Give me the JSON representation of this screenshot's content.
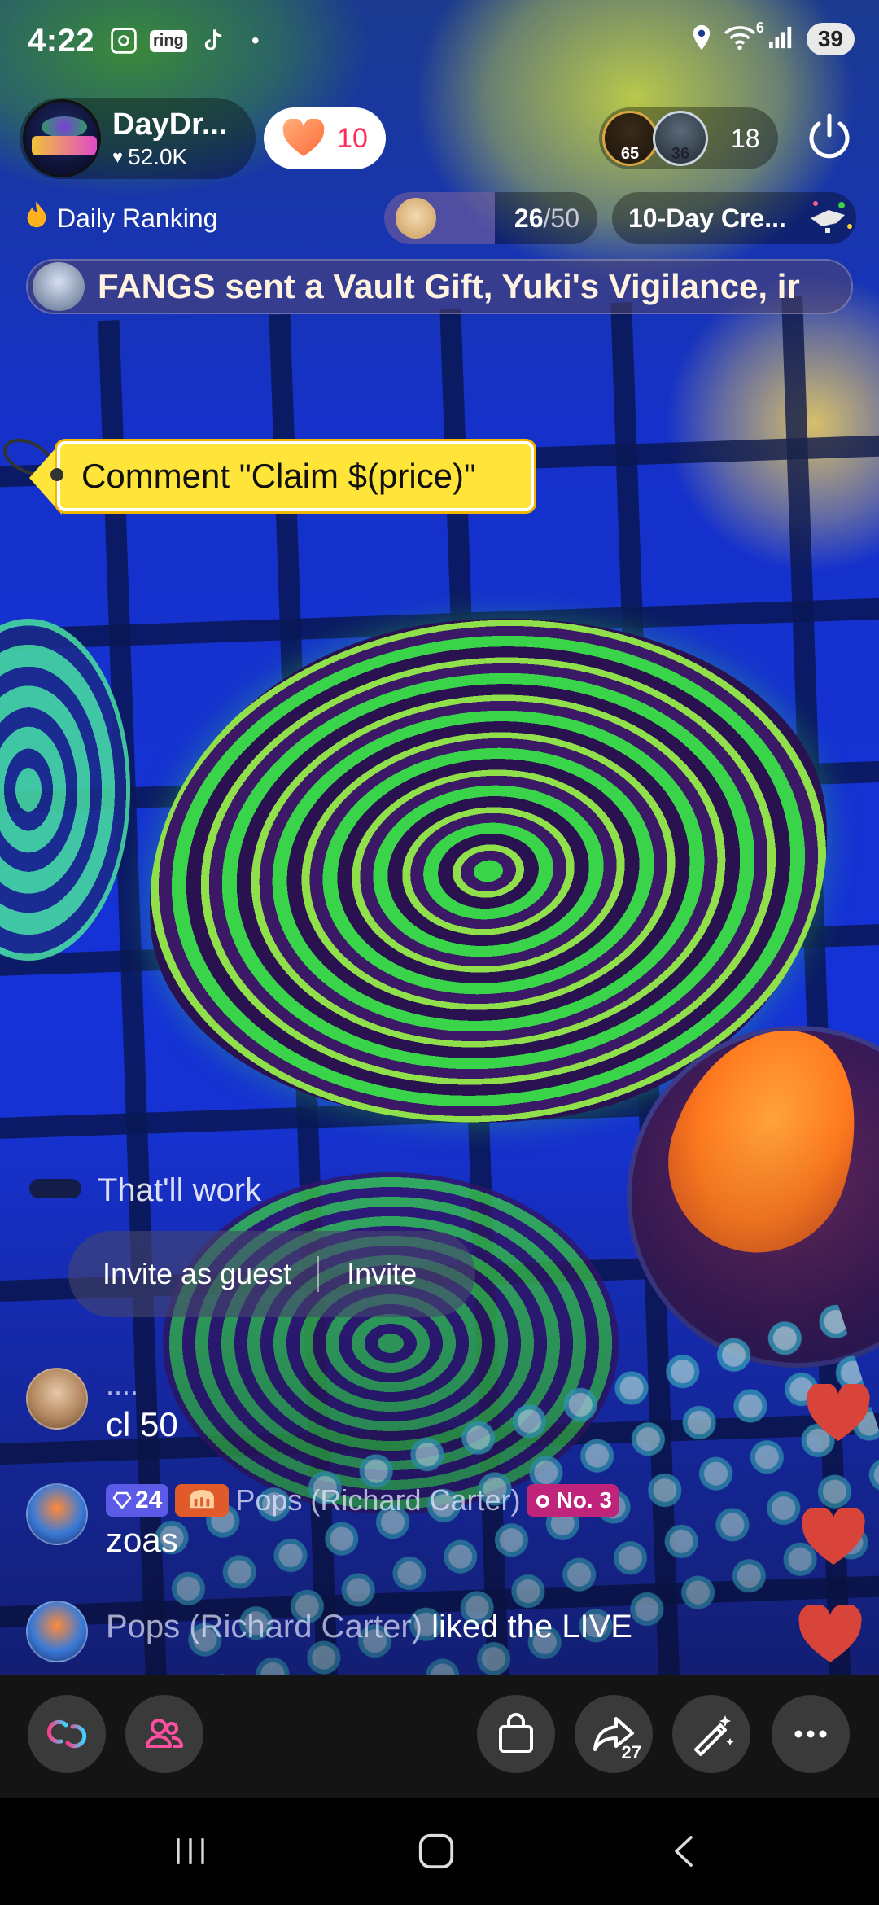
{
  "status_bar": {
    "time": "4:22",
    "left_icons": [
      "screenshot-icon",
      "ring-icon",
      "tiktok-icon",
      "dot-icon"
    ],
    "ring_label": "ring",
    "right_icons": [
      "location-icon",
      "wifi-icon",
      "signal-icon"
    ],
    "wifi_label": "6",
    "battery": "39"
  },
  "host": {
    "name": "DayDr...",
    "likes": "52.0K"
  },
  "follow": {
    "count": "10"
  },
  "viewers": {
    "badge_1": "65",
    "badge_2": "36",
    "count": "18"
  },
  "ranking": {
    "label": "Daily Ranking",
    "progress_current": "26",
    "progress_total": "/50",
    "progress_fraction": 0.52,
    "challenge_label": "10-Day Cre..."
  },
  "gift_banner": {
    "text": "FANGS sent a Vault Gift, Yuki's Vigilance, ir"
  },
  "claim_tag": {
    "text": "Comment \"Claim $(price)\""
  },
  "chat": {
    "faded_message": "That'll work",
    "invite": {
      "guest_label": "Invite as guest",
      "invite_label": "Invite"
    },
    "messages": [
      {
        "user": "....",
        "text": "cl 50"
      },
      {
        "level": "24",
        "user": "Pops (Richard Carter)",
        "rank": "No. 3",
        "text": "zoas"
      }
    ],
    "like_event": {
      "user": "Pops (Richard Carter)",
      "text": "liked the LIVE"
    }
  },
  "toolbar": {
    "share_count": "27"
  },
  "colors": {
    "accent_red": "#fe2c55",
    "claim_yellow": "#ffe43a",
    "heart_red": "#d9443a"
  }
}
